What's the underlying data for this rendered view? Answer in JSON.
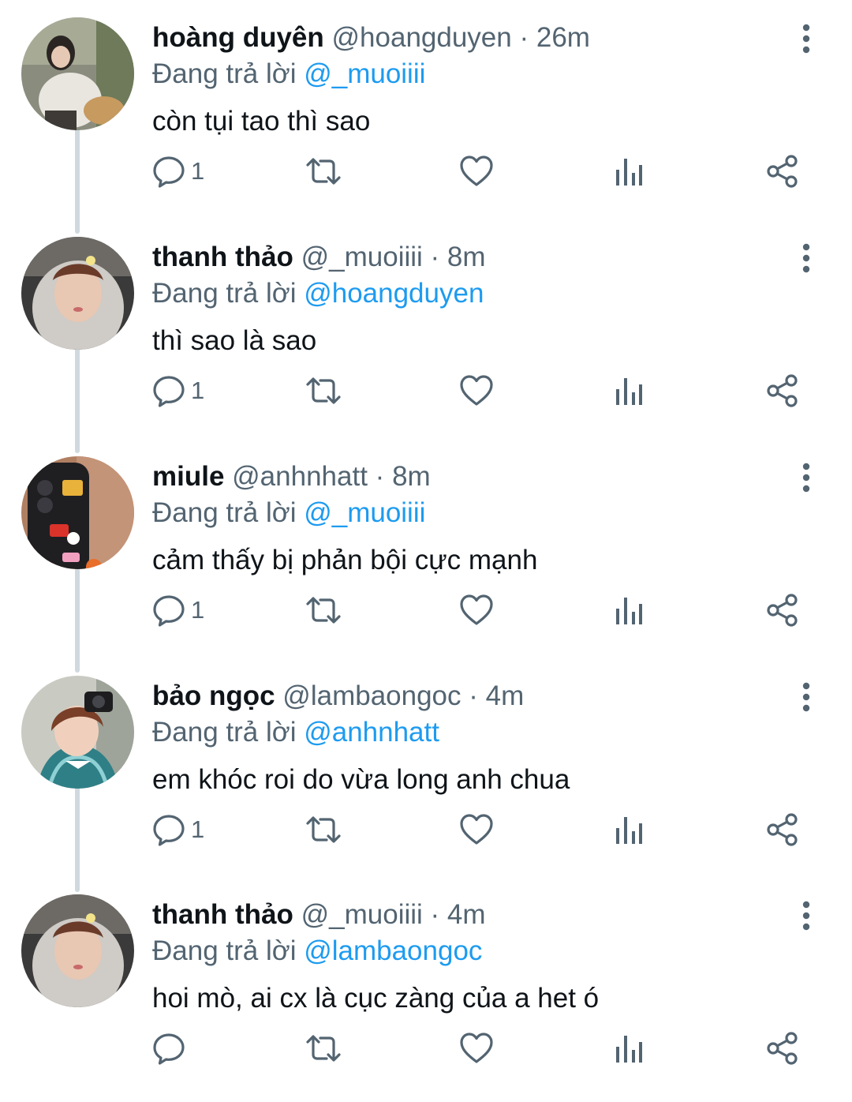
{
  "tweets": [
    {
      "name": "hoàng duyên",
      "handle": "@hoangduyen",
      "sep": "·",
      "time": "26m",
      "reply_prefix": "Đang trả lời",
      "reply_to": "@_muoiiii",
      "text": "còn tụi tao thì sao",
      "reply_count": "1"
    },
    {
      "name": "thanh thảo",
      "handle": "@_muoiiii",
      "sep": "·",
      "time": "8m",
      "reply_prefix": "Đang trả lời",
      "reply_to": "@hoangduyen",
      "text": "thì sao là sao",
      "reply_count": "1"
    },
    {
      "name": "miule",
      "handle": "@anhnhatt",
      "sep": "·",
      "time": "8m",
      "reply_prefix": "Đang trả lời",
      "reply_to": "@_muoiiii",
      "text": "cảm thấy bị phản bội cực mạnh",
      "reply_count": "1"
    },
    {
      "name": "bảo ngọc",
      "handle": "@lambaongoc",
      "sep": "·",
      "time": "4m",
      "reply_prefix": "Đang trả lời",
      "reply_to": "@anhnhatt",
      "text": "em khóc roi do vừa long anh chua",
      "reply_count": "1"
    },
    {
      "name": "thanh thảo",
      "handle": "@_muoiiii",
      "sep": "·",
      "time": "4m",
      "reply_prefix": "Đang trả lời",
      "reply_to": "@lambaongoc",
      "text": "hoi mò, ai cx là cục zàng của a het ó",
      "reply_count": ""
    }
  ],
  "icons": {
    "reply": "reply-icon",
    "retweet": "retweet-icon",
    "like": "like-icon",
    "views": "views-icon",
    "share": "share-icon",
    "more": "more-icon"
  },
  "colors": {
    "text_primary": "#0f1419",
    "text_secondary": "#536471",
    "mention_blue": "#1d9bf0",
    "thread_line": "#cfd9de"
  }
}
